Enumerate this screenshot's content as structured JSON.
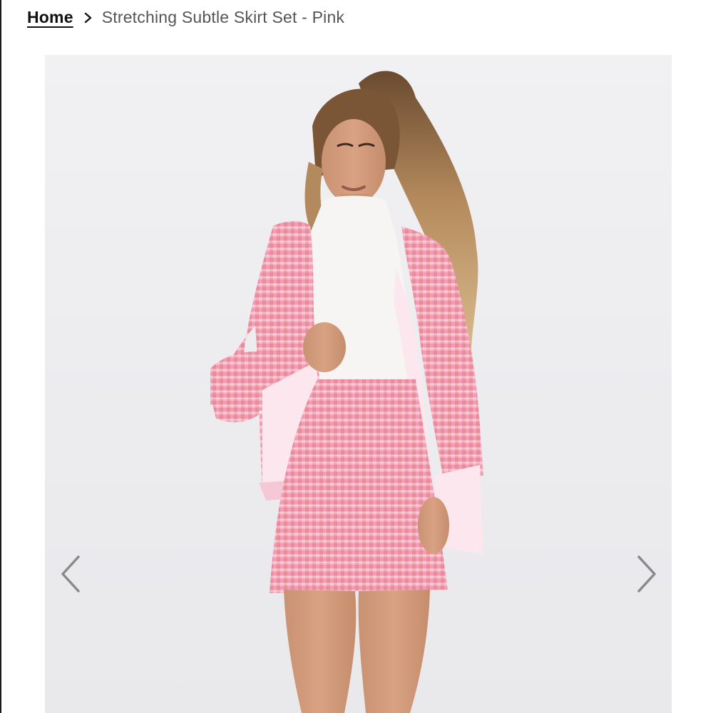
{
  "breadcrumb": {
    "home_label": "Home",
    "separator_icon": "chevron-right-icon",
    "current_label": "Stretching Subtle Skirt Set - Pink"
  },
  "gallery": {
    "image_alt": "Stretching Subtle Skirt Set - Pink",
    "prev_icon": "chevron-left-icon",
    "next_icon": "chevron-right-icon"
  },
  "colors": {
    "text_primary": "#111111",
    "text_secondary": "#555555",
    "arrow": "#8a8a8a",
    "photo_background": "#ececef",
    "tweed_pink": "#ef9fb4"
  }
}
